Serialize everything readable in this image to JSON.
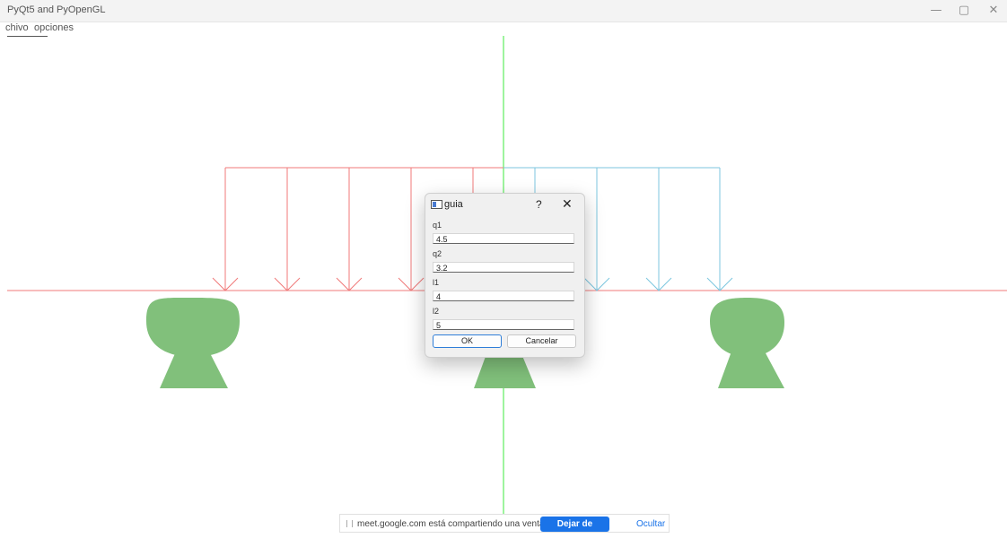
{
  "window": {
    "title": "PyQt5 and PyOpenGL",
    "controls": {
      "minimize": "—",
      "restore": "▢",
      "close": "✕"
    }
  },
  "menu": {
    "items": [
      "chivo",
      "opciones"
    ]
  },
  "canvas": {
    "colors": {
      "axis_vertical": "#7ef07e",
      "beam": "#f07a7a",
      "load_q1": "#f07a7a",
      "load_q2": "#7cc6df",
      "support": "#81c07b"
    }
  },
  "dialog": {
    "title": "guia",
    "help": "?",
    "close": "✕",
    "fields": [
      {
        "label": "q1",
        "value": "4.5"
      },
      {
        "label": "q2",
        "value": "3.2"
      },
      {
        "label": "l1",
        "value": "4"
      },
      {
        "label": "l2",
        "value": "5"
      }
    ],
    "ok_label": "OK",
    "cancel_label": "Cancelar"
  },
  "share_bar": {
    "message": "meet.google.com está compartiendo una ventana.",
    "stop_label": "Dejar de compartir",
    "hide_label": "Ocultar"
  }
}
